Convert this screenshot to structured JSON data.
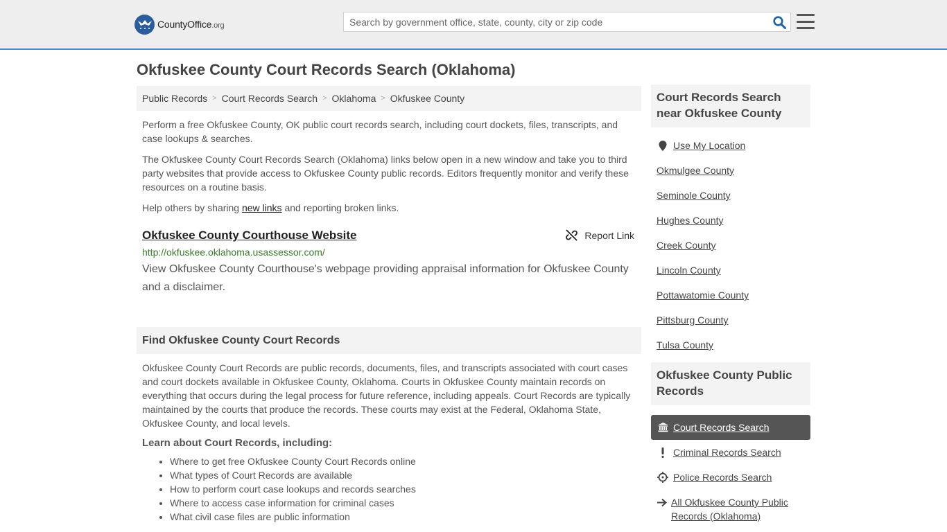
{
  "header": {
    "logo_main": "CountyOffice",
    "logo_suffix": ".org",
    "search_placeholder": "Search by government office, state, county, city or zip code"
  },
  "page_title": "Okfuskee County Court Records Search (Oklahoma)",
  "breadcrumb": [
    "Public Records",
    "Court Records Search",
    "Oklahoma",
    "Okfuskee County"
  ],
  "intro": {
    "p1": "Perform a free Okfuskee County, OK public court records search, including court dockets, files, transcripts, and case lookups & searches.",
    "p2": "The Okfuskee County Court Records Search (Oklahoma) links below open in a new window and take you to third party websites that provide access to Okfuskee County public records. Editors frequently monitor and verify these resources on a routine basis.",
    "p3_before": "Help others by sharing ",
    "p3_link": "new links",
    "p3_after": " and reporting broken links."
  },
  "result": {
    "title": "Okfuskee County Courthouse Website",
    "report_label": "Report Link",
    "url": "http://okfuskee.oklahoma.usassessor.com/",
    "description": "View Okfuskee County Courthouse's webpage providing appraisal information for Okfuskee County and a disclaimer."
  },
  "find_section": {
    "heading": "Find Okfuskee County Court Records",
    "body": "Okfuskee County Court Records are public records, documents, files, and transcripts associated with court cases and court dockets available in Okfuskee County, Oklahoma. Courts in Okfuskee County maintain records on everything that occurs during the legal process for future reference, including appeals. Court Records are typically maintained by the courts that produce the records. These courts may exist at the Federal, Oklahoma State, Okfuskee County, and local levels.",
    "learn_heading": "Learn about Court Records, including:",
    "learn_items": [
      "Where to get free Okfuskee County Court Records online",
      "What types of Court Records are available",
      "How to perform court case lookups and records searches",
      "Where to access case information for criminal cases",
      "What civil case files are public information"
    ]
  },
  "sidebar": {
    "nearby_heading": "Court Records Search near Okfuskee County",
    "use_location": "Use My Location",
    "counties": [
      "Okmulgee County",
      "Seminole County",
      "Hughes County",
      "Creek County",
      "Lincoln County",
      "Pottawatomie County",
      "Pittsburg County",
      "Tulsa County"
    ],
    "public_heading": "Okfuskee County Public Records",
    "nav": [
      {
        "label": "Court Records Search",
        "icon": "courthouse-icon"
      },
      {
        "label": "Criminal Records Search",
        "icon": "exclamation-icon"
      },
      {
        "label": "Police Records Search",
        "icon": "crosshair-icon"
      },
      {
        "label": "All Okfuskee County Public Records (Oklahoma)",
        "icon": "arrow-right-icon"
      }
    ]
  },
  "colors": {
    "accent": "#4a89c8",
    "logo_blue": "#2b5c9e",
    "url_green": "#3a7a2a",
    "active_nav": "#555555"
  }
}
